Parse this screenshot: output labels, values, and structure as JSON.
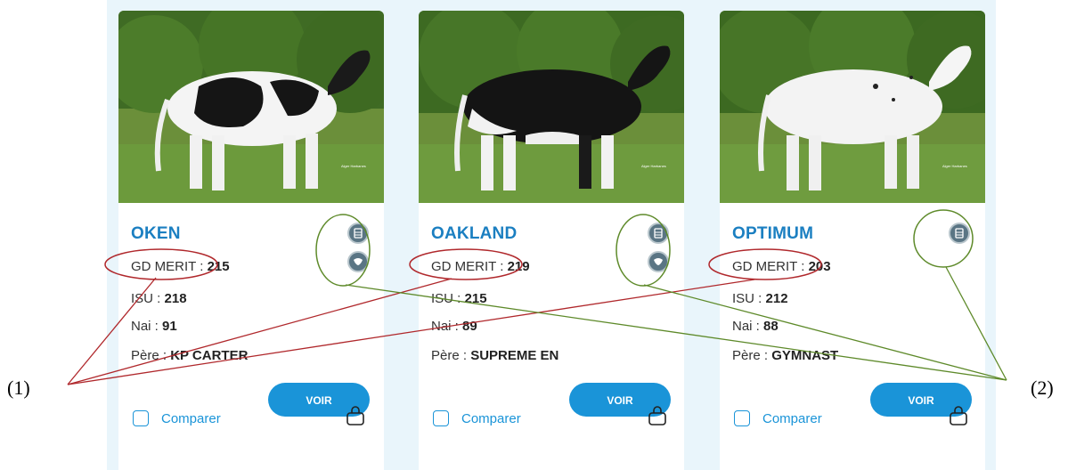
{
  "cards": [
    {
      "name": "OKEN",
      "gd_label": "GD MERIT : ",
      "gd_value": "215",
      "isu_label": "ISU : ",
      "isu_value": "218",
      "nai_label": "Nai : ",
      "nai_value": "91",
      "pere_label": "Père : ",
      "pere_value": "KP CARTER",
      "button": "VOIR",
      "compare": "Comparer",
      "photo_credit": "Alger Harbanes",
      "badges": [
        "polled-icon",
        "genomic-icon"
      ]
    },
    {
      "name": "OAKLAND",
      "gd_label": "GD MERIT : ",
      "gd_value": "219",
      "isu_label": "ISU : ",
      "isu_value": "215",
      "nai_label": "Nai : ",
      "nai_value": "89",
      "pere_label": "Père : ",
      "pere_value": "SUPREME EN",
      "button": "VOIR",
      "compare": "Comparer",
      "photo_credit": "Alger Harbanes",
      "badges": [
        "polled-icon",
        "genomic-icon"
      ]
    },
    {
      "name": "OPTIMUM",
      "gd_label": "GD MERIT : ",
      "gd_value": "203",
      "isu_label": "ISU : ",
      "isu_value": "212",
      "nai_label": "Nai : ",
      "nai_value": "88",
      "pere_label": "Père : ",
      "pere_value": "GYMNAST",
      "button": "VOIR",
      "compare": "Comparer",
      "photo_credit": "Alger Harbanes",
      "badges": [
        "polled-icon"
      ]
    }
  ],
  "annotations": {
    "label_1": "(1)",
    "label_2": "(2)",
    "color_1": "#b0282c",
    "color_2": "#5e8a2a"
  },
  "colors": {
    "accent": "#1a94d8",
    "name": "#1b7fc1",
    "background": "#e9f5fb"
  }
}
